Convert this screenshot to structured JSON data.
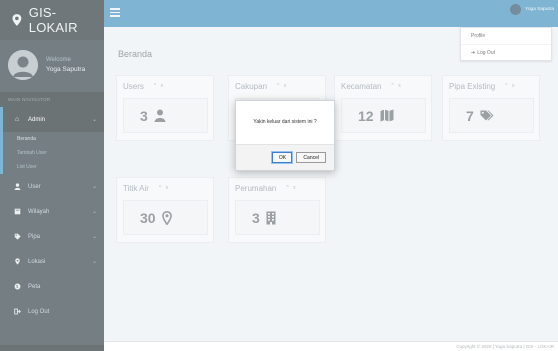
{
  "colors": {
    "sidebar": "#2c3b41",
    "navbar": "#3c8dbc",
    "content": "#ecf0f5",
    "accent": "#3c8dbc"
  },
  "brand": {
    "title": "GIS-LOKAIR",
    "icon": "map-marker-icon"
  },
  "user_panel": {
    "welcome": "Welcome",
    "name": "Yoga Saputra"
  },
  "nav_header": "MAIN NAVIGATOR",
  "sidebar": {
    "items": [
      {
        "label": "Admin",
        "icon": "home-icon",
        "expanded": true,
        "children": [
          "Beranda",
          "Tambah User",
          "List User"
        ]
      },
      {
        "label": "User",
        "icon": "user-icon"
      },
      {
        "label": "Wilayah",
        "icon": "book-icon"
      },
      {
        "label": "Pipa",
        "icon": "tag-icon"
      },
      {
        "label": "Lokasi",
        "icon": "map-marker-icon"
      },
      {
        "label": "Peta",
        "icon": "globe-icon"
      },
      {
        "label": "Log Out",
        "icon": "sign-out-icon"
      }
    ]
  },
  "navbar": {
    "user_name": "Yoga Saputra"
  },
  "dropdown": {
    "items": [
      "Profile",
      "Log Out"
    ]
  },
  "content": {
    "header": "Beranda"
  },
  "cards": [
    {
      "title": "Users",
      "value": "3",
      "icon": "user-icon",
      "tools": "^ x"
    },
    {
      "title": "Cakupan",
      "value": "",
      "icon": "",
      "tools": "^ x"
    },
    {
      "title": "Kecamatan",
      "value": "12",
      "icon": "map-icon",
      "tools": "^ x"
    },
    {
      "title": "Pipa Existing",
      "value": "7",
      "icon": "tags-icon",
      "tools": "^ x"
    },
    {
      "title": "Titik Air",
      "value": "30",
      "icon": "map-marker-icon",
      "tools": "^ x"
    },
    {
      "title": "Perumahan",
      "value": "3",
      "icon": "building-icon",
      "tools": "^ x"
    }
  ],
  "modal": {
    "message": "Yakin keluar dari sistem ini ?",
    "ok": "OK",
    "cancel": "Cancel"
  },
  "footer": {
    "text": "Copyright © 2020 | Yoga Saputra | GIS - LOKAIR"
  }
}
